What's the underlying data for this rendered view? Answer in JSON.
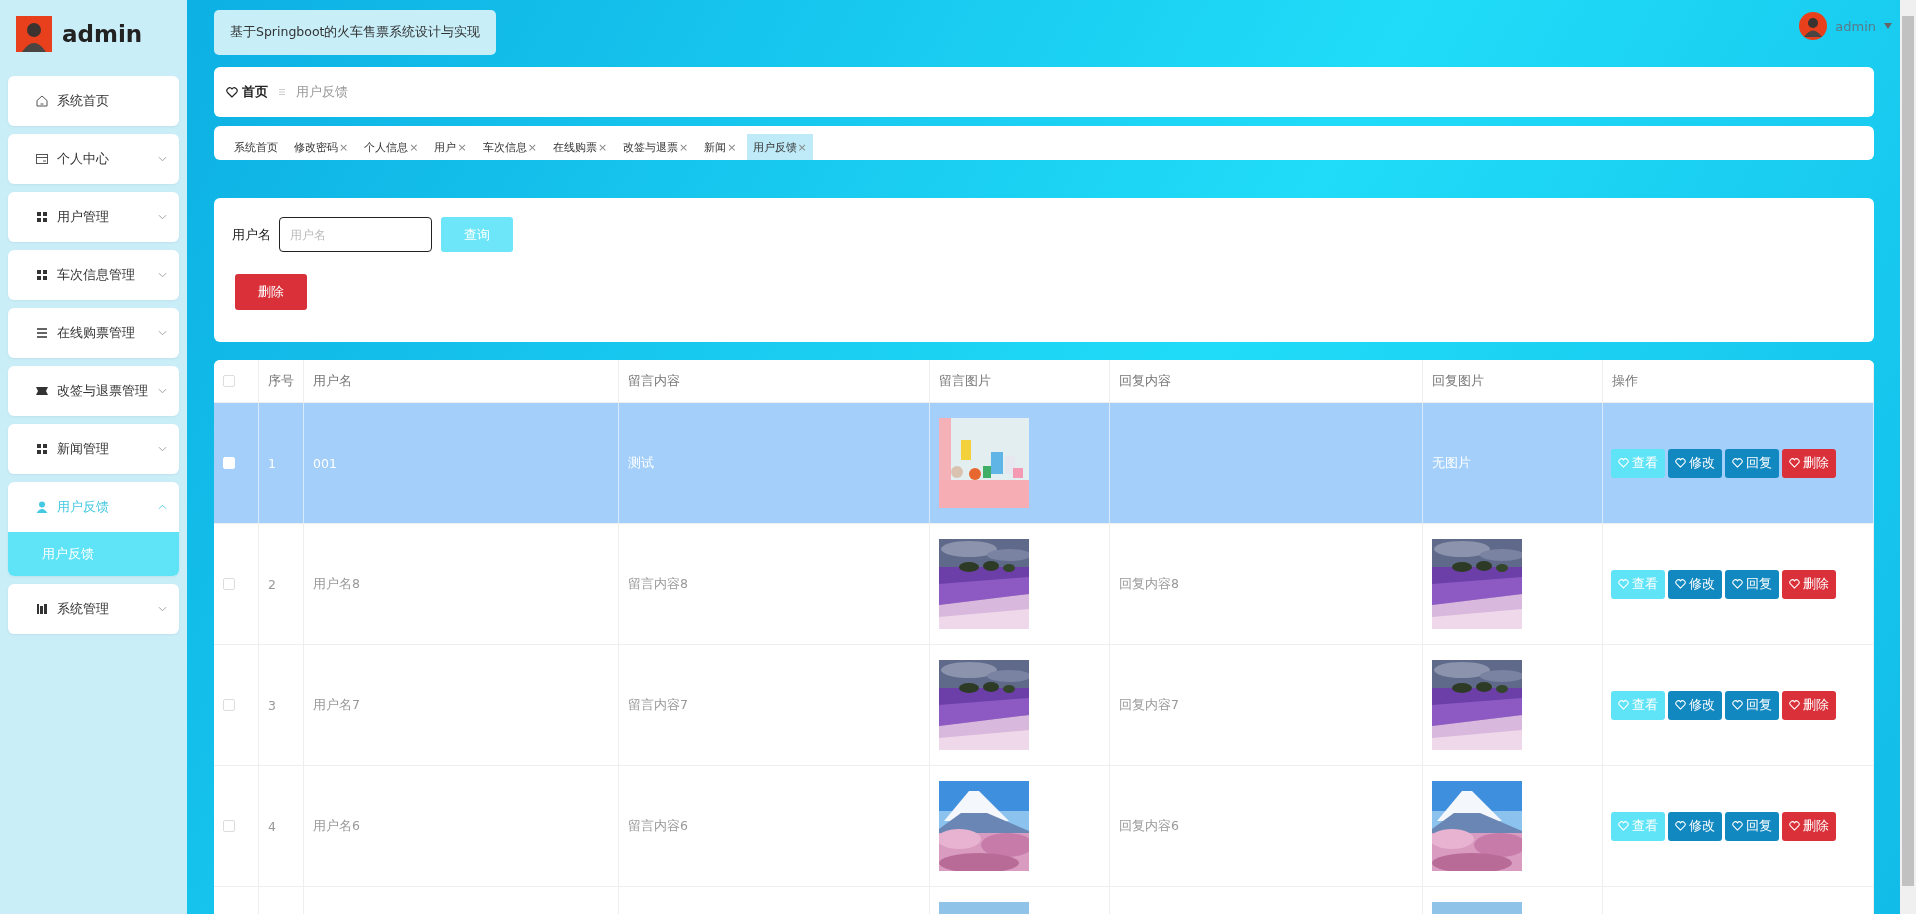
{
  "sidebar": {
    "title": "admin",
    "menu": [
      {
        "label": "系统首页"
      },
      {
        "label": "个人中心",
        "expanded": false
      },
      {
        "label": "用户管理",
        "expanded": false
      },
      {
        "label": "车次信息管理",
        "expanded": false
      },
      {
        "label": "在线购票管理",
        "expanded": false
      },
      {
        "label": "改签与退票管理",
        "expanded": false
      },
      {
        "label": "新闻管理",
        "expanded": false
      },
      {
        "label": "用户反馈",
        "expanded": true,
        "children": [
          {
            "label": "用户反馈",
            "selected": true
          }
        ]
      },
      {
        "label": "系统管理",
        "expanded": false
      }
    ]
  },
  "header": {
    "title": "基于Springboot的火车售票系统设计与实现",
    "user": "admin"
  },
  "breadcrumb": [
    "首页",
    "用户反馈"
  ],
  "tabs": [
    {
      "label": "系统首页",
      "closable": false,
      "selected": false
    },
    {
      "label": "修改密码",
      "closable": true,
      "selected": false
    },
    {
      "label": "个人信息",
      "closable": true,
      "selected": false
    },
    {
      "label": "用户",
      "closable": true,
      "selected": false
    },
    {
      "label": "车次信息",
      "closable": true,
      "selected": false
    },
    {
      "label": "在线购票",
      "closable": true,
      "selected": false
    },
    {
      "label": "改签与退票",
      "closable": true,
      "selected": false
    },
    {
      "label": "新闻",
      "closable": true,
      "selected": false
    },
    {
      "label": "用户反馈",
      "closable": true,
      "selected": true
    }
  ],
  "tab_close": "×",
  "search": {
    "label": "用户名",
    "placeholder": "用户名",
    "button": "查询",
    "delete_button": "删除"
  },
  "table": {
    "select_all": {
      "checked": false
    },
    "columns": [
      "序号",
      "用户名",
      "留言内容",
      "留言图片",
      "回复内容",
      "回复图片",
      "操作"
    ],
    "rows": [
      {
        "selected": true,
        "index": "1",
        "username": "001",
        "message": "测试",
        "message_image": {
          "kind": "picture"
        },
        "reply_image_text": "无图片",
        "actions": [
          {
            "label": "查看",
            "kind": "view"
          },
          {
            "label": "修改",
            "kind": "edit"
          },
          {
            "label": "回复",
            "kind": "reply"
          },
          {
            "label": "删除",
            "kind": "delete"
          }
        ]
      },
      {
        "selected": false,
        "index": "2",
        "username": "用户名8",
        "message": "留言内容8",
        "message_image": {
          "kind": "picture"
        },
        "reply": "回复内容8",
        "reply_image": {
          "kind": "picture"
        },
        "actions": [
          {
            "label": "查看",
            "kind": "view"
          },
          {
            "label": "修改",
            "kind": "edit"
          },
          {
            "label": "回复",
            "kind": "reply"
          },
          {
            "label": "删除",
            "kind": "delete"
          }
        ]
      },
      {
        "selected": false,
        "index": "3",
        "username": "用户名7",
        "message": "留言内容7",
        "message_image": {
          "kind": "picture"
        },
        "reply": "回复内容7",
        "reply_image": {
          "kind": "picture"
        },
        "actions": [
          {
            "label": "查看",
            "kind": "view"
          },
          {
            "label": "修改",
            "kind": "edit"
          },
          {
            "label": "回复",
            "kind": "reply"
          },
          {
            "label": "删除",
            "kind": "delete"
          }
        ]
      },
      {
        "selected": false,
        "index": "4",
        "username": "用户名6",
        "message": "留言内容6",
        "message_image": {
          "kind": "picture"
        },
        "reply": "回复内容6",
        "reply_image": {
          "kind": "picture"
        },
        "actions": [
          {
            "label": "查看",
            "kind": "view"
          },
          {
            "label": "修改",
            "kind": "edit"
          },
          {
            "label": "回复",
            "kind": "reply"
          },
          {
            "label": "删除",
            "kind": "delete"
          }
        ]
      },
      {
        "selected": false,
        "message_image": {
          "kind": "picture"
        },
        "reply_image": {
          "kind": "picture"
        }
      }
    ]
  }
}
